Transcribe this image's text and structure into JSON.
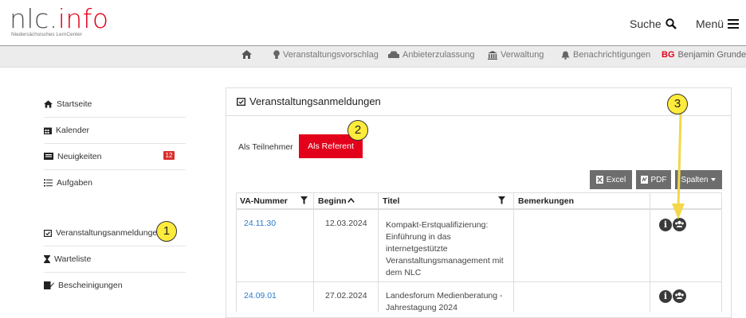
{
  "header": {
    "logo_main": "nlc.",
    "logo_accent": "info",
    "logo_sub": "Niedersächsisches LernCenter",
    "search_label": "Suche",
    "menu_label": "Menü"
  },
  "subnav": {
    "items": [
      {
        "label": "Veranstaltungsvorschlag",
        "icon": "lightbulb-icon"
      },
      {
        "label": "Anbieterzulassung",
        "icon": "car-icon"
      },
      {
        "label": "Verwaltung",
        "icon": "bank-icon"
      },
      {
        "label": "Benachrichtigungen",
        "icon": "bell-icon"
      }
    ],
    "user_initials": "BG",
    "user_name": "Benjamin Grundei"
  },
  "sidebar": {
    "items": [
      {
        "label": "Startseite",
        "icon": "home-icon"
      },
      {
        "label": "Kalender",
        "icon": "calendar-icon"
      },
      {
        "label": "Neuigkeiten",
        "icon": "newspaper-icon",
        "badge": "12"
      },
      {
        "label": "Aufgaben",
        "icon": "tasks-icon"
      },
      {
        "label": "Veranstaltungsanmeldungen",
        "icon": "calendar-check-icon"
      },
      {
        "label": "Warteliste",
        "icon": "hourglass-icon"
      },
      {
        "label": "Bescheinigungen",
        "icon": "certificate-icon"
      }
    ]
  },
  "callouts": [
    "1",
    "2",
    "3"
  ],
  "panel": {
    "title": "Veranstaltungsanmeldungen",
    "tabs": [
      "Als Teilnehmer",
      "Als Referent"
    ],
    "buttons": {
      "excel": "Excel",
      "pdf": "PDF",
      "columns": "Spalten"
    }
  },
  "table": {
    "headers": [
      "VA-Nummer",
      "Beginn",
      "Titel",
      "Bemerkungen"
    ],
    "rows": [
      {
        "va": "24.11.30",
        "beginn": "12.03.2024",
        "titel_lines": [
          "Kompakt-Erstqualifizierung:",
          "Einführung in das",
          "internetgestützte",
          "Veranstaltungsmanagement mit",
          "dem NLC"
        ],
        "bemerkungen": ""
      },
      {
        "va": "24.09.01",
        "beginn": "27.02.2024",
        "titel_lines": [
          "Landesforum Medienberatung -",
          "Jahrestagung 2024"
        ],
        "bemerkungen": ""
      }
    ]
  },
  "colors": {
    "accent": "#e2001a",
    "link": "#2a7bc9",
    "callout": "#ffeb3b",
    "arrow": "#f2d84a"
  }
}
